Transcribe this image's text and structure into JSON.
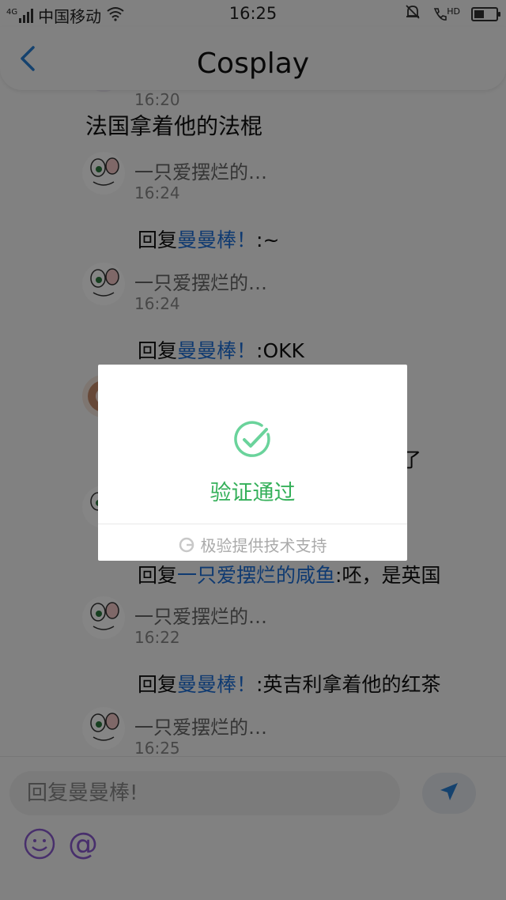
{
  "status_bar": {
    "signal_label": "4G",
    "carrier": "中国移动",
    "time": "16:25",
    "hd_label": "HD"
  },
  "header": {
    "title": "Cosplay"
  },
  "feed": {
    "top_partial_time": "16:20",
    "top_partial_text": "法国拿着他的法棍",
    "posts": [
      {
        "user": "一只爱摆烂的…",
        "time": "16:24",
        "reply_prefix": "回复",
        "reply_target": "曼曼棒！",
        "reply_text": ":~"
      },
      {
        "user": "一只爱摆烂的…",
        "time": "16:24",
        "reply_prefix": "回复",
        "reply_target": "曼曼棒！",
        "reply_text": ":OKK"
      },
      {
        "partial_text": "了"
      },
      {
        "reply_prefix": "回复",
        "reply_target": "一只爱摆烂的咸鱼",
        "reply_text": ":呸，是英国"
      },
      {
        "user": "一只爱摆烂的…",
        "time": "16:22",
        "reply_prefix": "回复",
        "reply_target": "曼曼棒！",
        "reply_text": ":英吉利拿着他的红茶"
      },
      {
        "user": "一只爱摆烂的…",
        "time": "16:25"
      }
    ]
  },
  "composer": {
    "placeholder": "回复曼曼棒!",
    "send_icon": "send-icon",
    "emoji_icon": "emoji-icon",
    "mention_icon": "@"
  },
  "dialog": {
    "message": "验证通过",
    "footer": "极验提供技术支持",
    "accent": "#35b05a"
  },
  "colors": {
    "link": "#1e6fd8",
    "background": "#f7f7f7"
  }
}
